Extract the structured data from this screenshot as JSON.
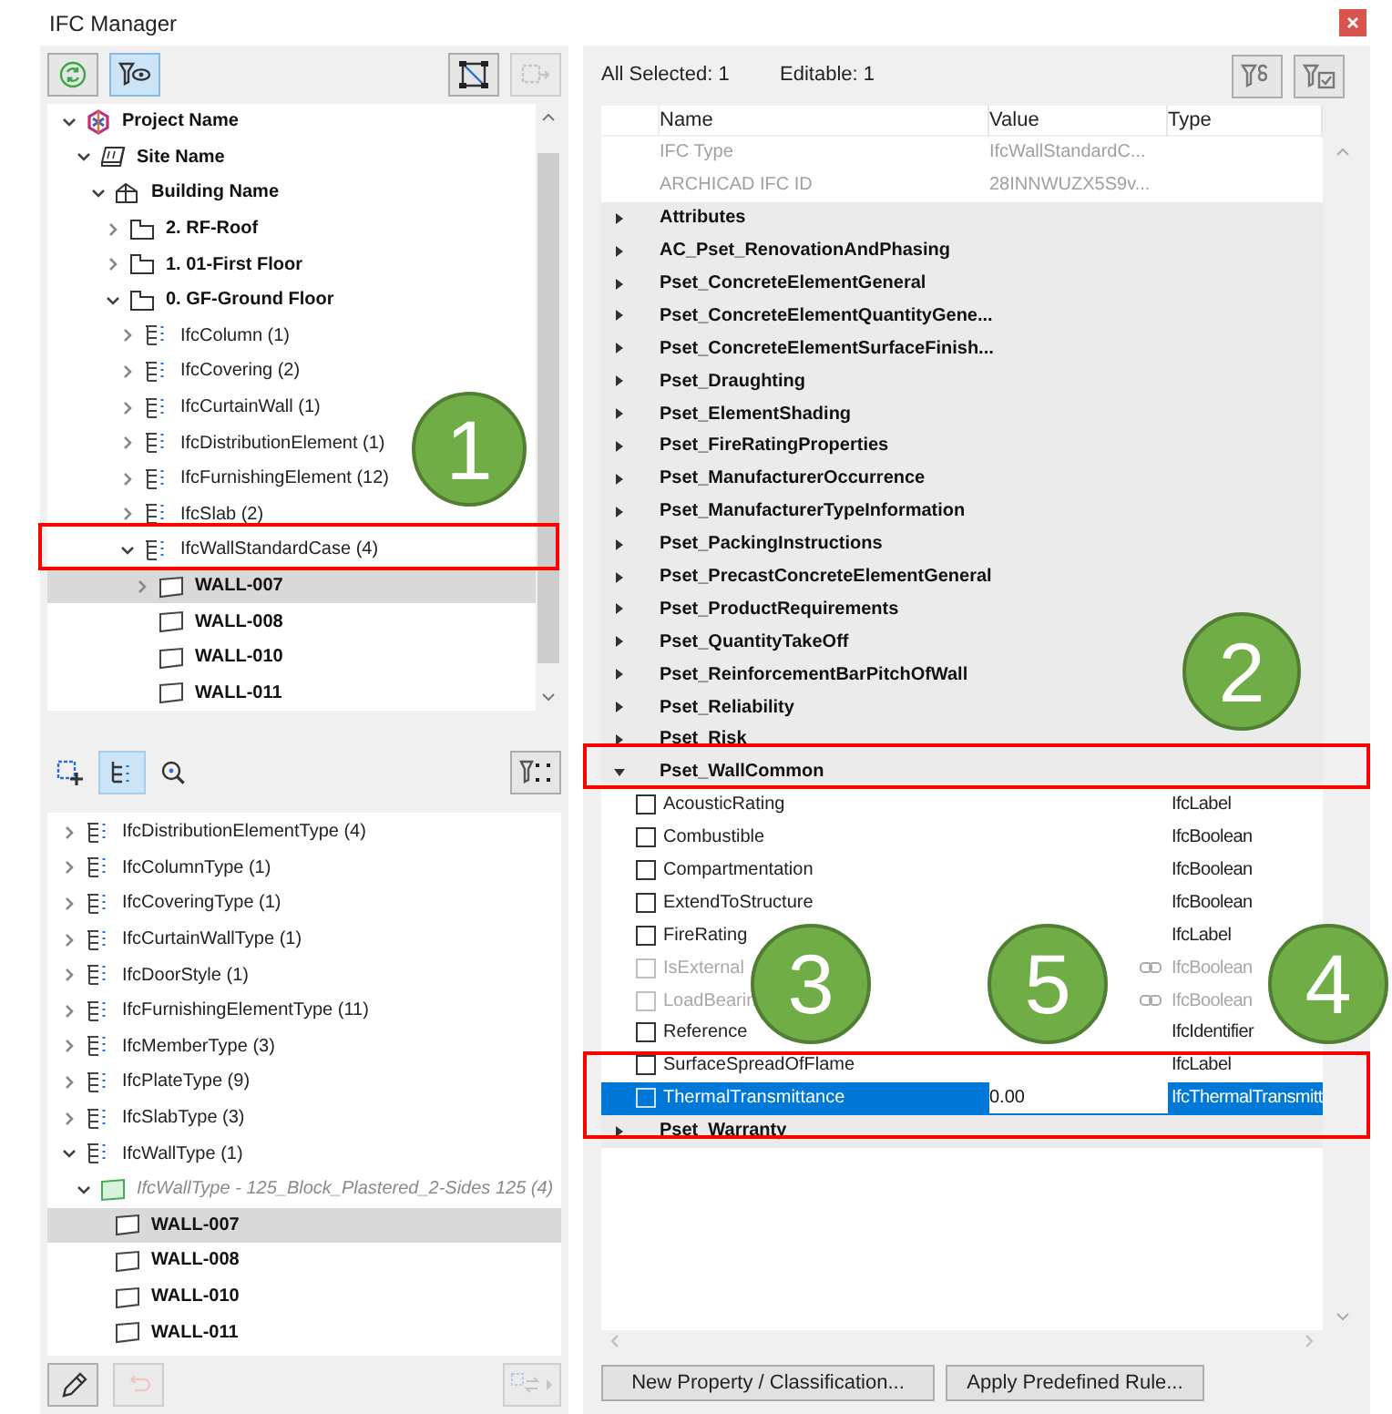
{
  "window": {
    "title": "IFC Manager"
  },
  "left_toolbar": [
    {
      "kind": "refresh",
      "pressed": false,
      "disabled": false
    },
    {
      "kind": "filter-view",
      "pressed": true,
      "disabled": false
    },
    {
      "kind": "nodes",
      "pressed": false,
      "disabled": false
    },
    {
      "kind": "export",
      "pressed": false,
      "disabled": true
    }
  ],
  "spatial_tree": [
    {
      "label": "Project Name",
      "kind": "project",
      "expanded": true,
      "selected": false,
      "children": [
        {
          "label": "Site Name",
          "kind": "site",
          "expanded": true,
          "selected": false,
          "children": [
            {
              "label": "Building Name",
              "kind": "building",
              "expanded": true,
              "selected": false,
              "children": [
                {
                  "label": "2. RF-Roof",
                  "kind": "storey",
                  "expanded": false,
                  "selected": false
                },
                {
                  "label": "1. 01-First Floor",
                  "kind": "storey",
                  "expanded": false,
                  "selected": false
                },
                {
                  "label": "0. GF-Ground Floor",
                  "kind": "storey",
                  "expanded": true,
                  "selected": false,
                  "children": [
                    {
                      "label": "IfcColumn (1)",
                      "kind": "class",
                      "expanded": false,
                      "selected": false
                    },
                    {
                      "label": "IfcCovering (2)",
                      "kind": "class",
                      "expanded": false,
                      "selected": false
                    },
                    {
                      "label": "IfcCurtainWall (1)",
                      "kind": "class",
                      "expanded": false,
                      "selected": false
                    },
                    {
                      "label": "IfcDistributionElement (1)",
                      "kind": "class",
                      "expanded": false,
                      "selected": false
                    },
                    {
                      "label": "IfcFurnishingElement (12)",
                      "kind": "class",
                      "expanded": false,
                      "selected": false
                    },
                    {
                      "label": "IfcSlab (2)",
                      "kind": "class",
                      "expanded": false,
                      "selected": false
                    },
                    {
                      "label": "IfcWallStandardCase (4)",
                      "kind": "class",
                      "expanded": true,
                      "selected": false,
                      "children": [
                        {
                          "label": "WALL-007",
                          "kind": "element",
                          "expanded": false,
                          "selected": true
                        },
                        {
                          "label": "WALL-008",
                          "kind": "element",
                          "selected": false
                        },
                        {
                          "label": "WALL-010",
                          "kind": "element",
                          "selected": false
                        },
                        {
                          "label": "WALL-011",
                          "kind": "element",
                          "selected": false
                        }
                      ]
                    }
                  ]
                }
              ]
            }
          ]
        }
      ]
    }
  ],
  "type_toolbar": [
    {
      "kind": "add-select",
      "pressed": false,
      "disabled": false
    },
    {
      "kind": "tree",
      "pressed": true,
      "disabled": false
    },
    {
      "kind": "zoom",
      "pressed": false,
      "disabled": false
    },
    {
      "kind": "filter-nodes",
      "pressed": false,
      "disabled": false
    }
  ],
  "type_tree": [
    {
      "label": "IfcDistributionElementType (4)",
      "kind": "class",
      "expanded": false,
      "selected": false
    },
    {
      "label": "IfcColumnType (1)",
      "kind": "class",
      "expanded": false,
      "selected": false
    },
    {
      "label": "IfcCoveringType (1)",
      "kind": "class",
      "expanded": false,
      "selected": false
    },
    {
      "label": "IfcCurtainWallType (1)",
      "kind": "class",
      "expanded": false,
      "selected": false
    },
    {
      "label": "IfcDoorStyle (1)",
      "kind": "class",
      "expanded": false,
      "selected": false
    },
    {
      "label": "IfcFurnishingElementType (11)",
      "kind": "class",
      "expanded": false,
      "selected": false
    },
    {
      "label": "IfcMemberType (3)",
      "kind": "class",
      "expanded": false,
      "selected": false
    },
    {
      "label": "IfcPlateType (9)",
      "kind": "class",
      "expanded": false,
      "selected": false
    },
    {
      "label": "IfcSlabType (3)",
      "kind": "class",
      "expanded": false,
      "selected": false
    },
    {
      "label": "IfcWallType (1)",
      "kind": "class",
      "expanded": true,
      "selected": false,
      "children": [
        {
          "label": "IfcWallType - 125_Block_Plastered_2-Sides 125 (4)",
          "kind": "type",
          "expanded": true,
          "selected": false,
          "children": [
            {
              "label": "WALL-007",
              "kind": "element",
              "selected": true
            },
            {
              "label": "WALL-008",
              "kind": "element",
              "selected": false
            },
            {
              "label": "WALL-010",
              "kind": "element",
              "selected": false
            },
            {
              "label": "WALL-011",
              "kind": "element",
              "selected": false
            }
          ]
        }
      ]
    }
  ],
  "bottom_toolbar": [
    {
      "kind": "edit",
      "pressed": false,
      "disabled": false
    },
    {
      "kind": "undo",
      "pressed": false,
      "disabled": true
    },
    {
      "kind": "reassign",
      "pressed": false,
      "disabled": true
    }
  ],
  "properties": {
    "selected_count": "All Selected: 1",
    "editable_count": "Editable: 1",
    "filters": [
      {
        "kind": "filter-pset"
      },
      {
        "kind": "filter-check"
      }
    ],
    "columns": [
      "Name",
      "Value",
      "Type"
    ],
    "rows": [
      {
        "kind": "info",
        "name": "IFC Type",
        "value": "IfcWallStandardC..."
      },
      {
        "kind": "info",
        "name": "ARCHICAD IFC ID",
        "value": "28INNWUZX5S9v..."
      },
      {
        "kind": "group",
        "name": "Attributes",
        "expanded": false
      },
      {
        "kind": "group",
        "name": "AC_Pset_RenovationAndPhasing",
        "expanded": false
      },
      {
        "kind": "group",
        "name": "Pset_ConcreteElementGeneral",
        "expanded": false
      },
      {
        "kind": "group",
        "name": "Pset_ConcreteElementQuantityGene...",
        "expanded": false
      },
      {
        "kind": "group",
        "name": "Pset_ConcreteElementSurfaceFinish...",
        "expanded": false
      },
      {
        "kind": "group",
        "name": "Pset_Draughting",
        "expanded": false
      },
      {
        "kind": "group",
        "name": "Pset_ElementShading",
        "expanded": false
      },
      {
        "kind": "group",
        "name": "Pset_FireRatingProperties",
        "expanded": false
      },
      {
        "kind": "group",
        "name": "Pset_ManufacturerOccurrence",
        "expanded": false
      },
      {
        "kind": "group",
        "name": "Pset_ManufacturerTypeInformation",
        "expanded": false
      },
      {
        "kind": "group",
        "name": "Pset_PackingInstructions",
        "expanded": false
      },
      {
        "kind": "group",
        "name": "Pset_PrecastConcreteElementGeneral",
        "expanded": false
      },
      {
        "kind": "group",
        "name": "Pset_ProductRequirements",
        "expanded": false
      },
      {
        "kind": "group",
        "name": "Pset_QuantityTakeOff",
        "expanded": false
      },
      {
        "kind": "group",
        "name": "Pset_ReinforcementBarPitchOfWall",
        "expanded": false
      },
      {
        "kind": "group",
        "name": "Pset_Reliability",
        "expanded": false
      },
      {
        "kind": "group",
        "name": "Pset_Risk",
        "expanded": false
      },
      {
        "kind": "group",
        "name": "Pset_WallCommon",
        "expanded": true
      },
      {
        "kind": "property",
        "name": "AcousticRating",
        "type": "IfcLabel",
        "checked": false,
        "disabled": false,
        "linked": false,
        "selected": false
      },
      {
        "kind": "property",
        "name": "Combustible",
        "type": "IfcBoolean",
        "checked": false,
        "disabled": false,
        "linked": false,
        "selected": false
      },
      {
        "kind": "property",
        "name": "Compartmentation",
        "type": "IfcBoolean",
        "checked": false,
        "disabled": false,
        "linked": false,
        "selected": false
      },
      {
        "kind": "property",
        "name": "ExtendToStructure",
        "type": "IfcBoolean",
        "checked": false,
        "disabled": false,
        "linked": false,
        "selected": false
      },
      {
        "kind": "property",
        "name": "FireRating",
        "type": "IfcLabel",
        "checked": false,
        "disabled": false,
        "linked": false,
        "selected": false
      },
      {
        "kind": "property",
        "name": "IsExternal",
        "type": "IfcBoolean",
        "checked": false,
        "disabled": true,
        "linked": true,
        "selected": false
      },
      {
        "kind": "property",
        "name": "LoadBearin",
        "type": "IfcBoolean",
        "checked": false,
        "disabled": true,
        "linked": true,
        "selected": false
      },
      {
        "kind": "property",
        "name": "Reference",
        "type": "IfcIdentifier",
        "checked": false,
        "disabled": false,
        "linked": false,
        "selected": false
      },
      {
        "kind": "property",
        "name": "SurfaceSpreadOfFlame",
        "type": "IfcLabel",
        "checked": false,
        "disabled": false,
        "linked": false,
        "selected": false
      },
      {
        "kind": "property",
        "name": "ThermalTransmittance",
        "value": "0.00",
        "type": "IfcThermalTransmitt",
        "checked": false,
        "disabled": false,
        "linked": false,
        "selected": true
      },
      {
        "kind": "group",
        "name": "Pset_Warranty",
        "expanded": false
      }
    ],
    "buttons": [
      "New Property / Classification...",
      "Apply Predefined Rule..."
    ]
  },
  "callouts": [
    {
      "label": "1"
    },
    {
      "label": "2"
    },
    {
      "label": "3"
    },
    {
      "label": "5"
    },
    {
      "label": "4"
    }
  ]
}
